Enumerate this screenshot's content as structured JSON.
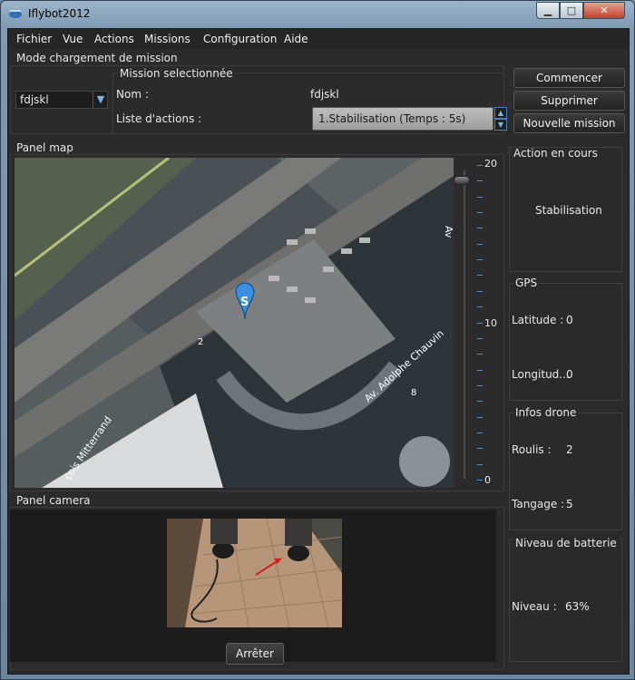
{
  "window": {
    "title": "Iflybot2012",
    "controls": {
      "minimize": "▁",
      "maximize": "□",
      "close": "✕"
    }
  },
  "menu": [
    "Fichier",
    "Vue",
    "Actions",
    "Missions",
    "Configuration",
    "Aide"
  ],
  "mode_section": {
    "title": "Mode chargement de mission",
    "selected_mission": "fdjskl"
  },
  "mission_section": {
    "title": "Mission selectionnée",
    "name_label": "Nom :",
    "name_value": "fdjskl",
    "actions_label": "Liste d'actions :",
    "actions_value": "1.Stabilisation (Temps : 5s)"
  },
  "buttons": {
    "start": "Commencer",
    "delete": "Supprimer",
    "new_mission": "Nouvelle mission",
    "stop": "Arrêter"
  },
  "map_panel": {
    "title": "Panel map",
    "marker_letter": "S",
    "street_labels": [
      "çois Mitterrand",
      "Av. Adolphe Chauvin",
      "Av",
      "2",
      "8"
    ],
    "zoom": {
      "max": "20",
      "mid": "10",
      "min": "0",
      "level": 20
    }
  },
  "camera_panel": {
    "title": "Panel camera"
  },
  "side": {
    "current_action": {
      "title": "Action en cours",
      "value": "Stabilisation"
    },
    "gps": {
      "title": "GPS",
      "lat_label": "Latitude :",
      "lat_value": "0",
      "lon_label": "Longitud...",
      "lon_value": "0"
    },
    "drone": {
      "title": "Infos drone",
      "roll_label": "Roulis :",
      "roll_value": "2",
      "pitch_label": "Tangage :",
      "pitch_value": "5"
    },
    "battery": {
      "title": "Niveau de batterie",
      "level_label": "Niveau :",
      "level_value": "63%"
    }
  },
  "colors": {
    "accent": "#4c8fd6",
    "panel_bg": "#2b2b2b",
    "map_road": "#707070",
    "map_marker": "#3b8fe0"
  }
}
